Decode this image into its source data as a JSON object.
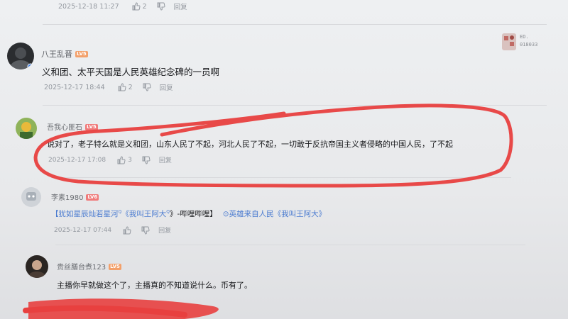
{
  "comments": [
    {
      "username": "",
      "text": "",
      "date": "2025-12-18 11:27",
      "likes": "2",
      "reply_label": "回复"
    },
    {
      "username": "八王乱晋",
      "level": "LV5",
      "text": "义和团、太平天国是人民英雄纪念碑的一员啊",
      "date": "2025-12-17 18:44",
      "likes": "2",
      "reply_label": "回复"
    },
    {
      "username": "吾我心匪石",
      "level": "LV5",
      "text": "说对了，老子特么就是义和团，山东人民了不起，河北人民了不起，一切敢于反抗帝国主义者侵略的中国人民，了不起",
      "date": "2025-12-17 17:08",
      "likes": "3",
      "reply_label": "回复"
    },
    {
      "username": "李素1980",
      "level": "LV6",
      "text_link_1": "【犹如星辰灿若星河",
      "text_link_2": "《我叫王阿大",
      "text_mid": "》-哔哩哔哩】",
      "text_link_3": "英雄来自人民《我叫王阿大》",
      "date": "2025-12-17 07:44",
      "reply_label": "回复"
    },
    {
      "username": "贵丝膳台煮123",
      "level": "LV5",
      "text": "主播你早就做这个了，主播真的不知道说什么。币有了。",
      "date": "",
      "reply_label": ""
    }
  ],
  "top_badge": {
    "line1": "ED.",
    "line2": "018033"
  },
  "colors": {
    "red_pen": "#e8403f",
    "link": "#4a7bd0"
  }
}
